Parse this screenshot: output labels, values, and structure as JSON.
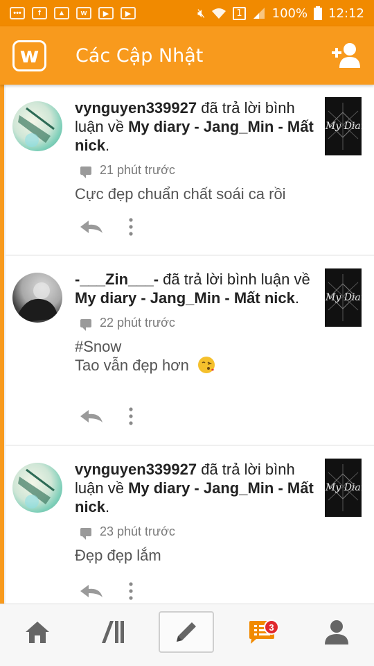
{
  "status_bar": {
    "battery": "100%",
    "time": "12:12",
    "sim_slot": "1"
  },
  "app_bar": {
    "logo": "w",
    "title": "Các Cập Nhật"
  },
  "feed": [
    {
      "user": "vynguyen339927",
      "action": " đã trả lời bình luận về ",
      "story": "My diary - Jang_Min - Mất nick",
      "end": ".",
      "time": "21 phút trước",
      "comment_lines": [
        "Cực đẹp chuẩn chất soái ca rồi"
      ],
      "thumb_text": "My Diary"
    },
    {
      "user": "-___Zin___-",
      "action": " đã trả lời bình luận về ",
      "story": "My diary - Jang_Min - Mất nick",
      "end": ".",
      "time": "22 phút trước",
      "comment_lines": [
        "#Snow",
        "Tao vẫn đẹp hơn"
      ],
      "thumb_text": "My Diary"
    },
    {
      "user": "vynguyen339927",
      "action": " đã trả lời bình luận về ",
      "story": "My diary - Jang_Min - Mất nick",
      "end": ".",
      "time": "23 phút trước",
      "comment_lines": [
        "Đẹp đẹp lắm"
      ],
      "thumb_text": "My Diary"
    }
  ],
  "bottom_nav": {
    "notification_count": "3",
    "items": [
      "home-icon",
      "library-icon",
      "write-icon",
      "updates-icon",
      "profile-icon"
    ]
  },
  "colors": {
    "brand_orange": "#f89a1d",
    "badge_red": "#e0282e"
  }
}
